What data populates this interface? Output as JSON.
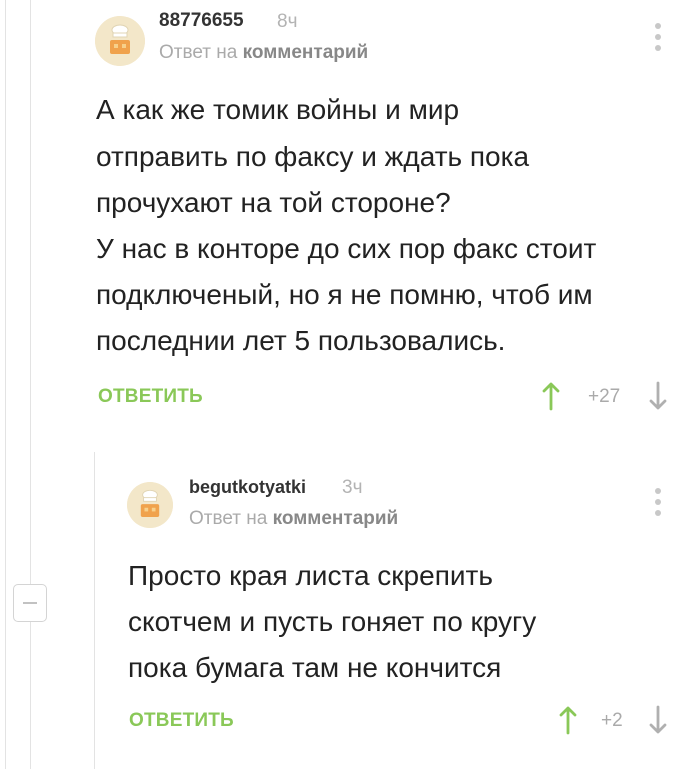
{
  "comments": [
    {
      "nick": "88776655",
      "time": "8ч",
      "reply_prefix": "Ответ на",
      "reply_link": "комментарий",
      "lines": [
        "А как же томик войны и мир",
        "отправить по факсу и ждать пока",
        "прочухают на той стороне?",
        "У нас в конторе до сих пор факс стоит",
        "подключеный, но я не помню, чтоб им",
        "последнии лет 5 пользовались."
      ],
      "reply_label": "ОТВЕТИТЬ",
      "rating": "+27"
    },
    {
      "nick": "begutkotyatki",
      "time": "3ч",
      "reply_prefix": "Ответ на",
      "reply_link": "комментарий",
      "lines": [
        "Просто края листа скрепить",
        "скотчем и пусть гоняет по кругу",
        "пока бумага там не кончится"
      ],
      "reply_label": "ОТВЕТИТЬ",
      "rating": "+2"
    }
  ],
  "icons": {
    "avatar": "default-avatar-chef-house",
    "more": "vertical-dots-icon",
    "upvote": "arrow-up-icon",
    "downvote": "arrow-down-icon",
    "collapse": "minus-icon"
  },
  "colors": {
    "accent": "#8ac858",
    "muted": "#aaaaaa",
    "thread_line": "#e3e3e3"
  }
}
